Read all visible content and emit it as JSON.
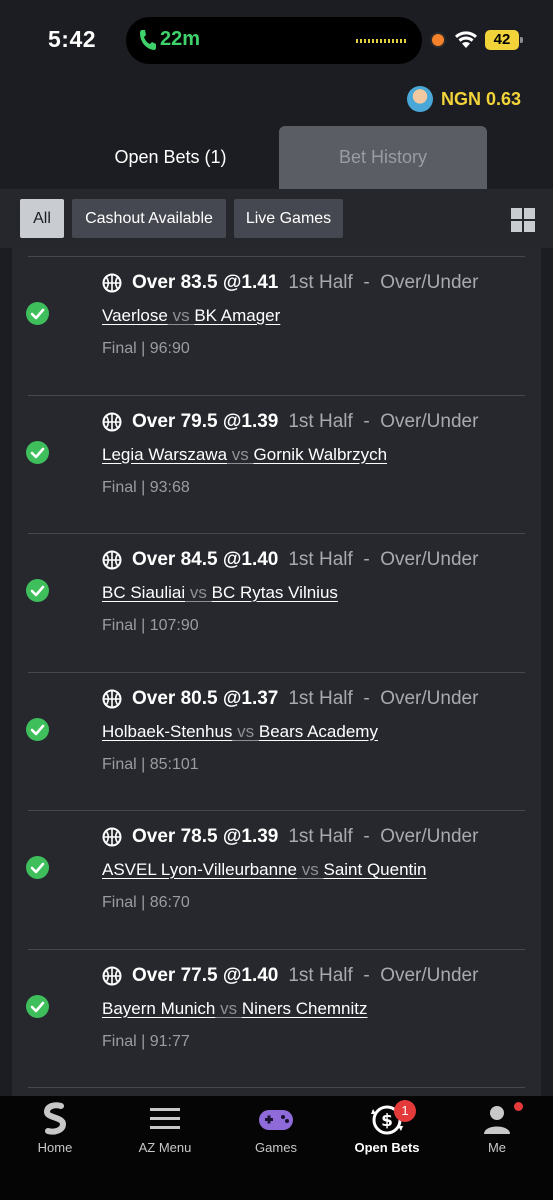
{
  "status_bar": {
    "time": "5:42",
    "call_duration": "22m",
    "battery": "42"
  },
  "balance": {
    "text": "NGN 0.63"
  },
  "tabs": [
    {
      "label": "Open Bets (1)",
      "active": true
    },
    {
      "label": "Bet History",
      "active": false
    }
  ],
  "filters": [
    {
      "label": "All",
      "active": true
    },
    {
      "label": "Cashout Available",
      "active": false
    },
    {
      "label": "Live Games",
      "active": false
    }
  ],
  "bets": [
    {
      "pick": "Over 83.5 @1.41",
      "market": "1st Half  -  Over/Under",
      "home": "Vaerlose",
      "vs": "vs",
      "away": "BK Amager",
      "result": "Final | 96:90"
    },
    {
      "pick": "Over 79.5 @1.39",
      "market": "1st Half  -  Over/Under",
      "home": "Legia Warszawa",
      "vs": "vs",
      "away": "Gornik Walbrzych",
      "result": "Final | 93:68"
    },
    {
      "pick": "Over 84.5 @1.40",
      "market": "1st Half  -  Over/Under",
      "home": "BC Siauliai",
      "vs": "vs",
      "away": "BC Rytas Vilnius",
      "result": "Final | 107:90"
    },
    {
      "pick": "Over 80.5 @1.37",
      "market": "1st Half  -  Over/Under",
      "home": "Holbaek-Stenhus",
      "vs": "vs",
      "away": "Bears Academy",
      "result": "Final | 85:101"
    },
    {
      "pick": "Over 78.5 @1.39",
      "market": "1st Half  -  Over/Under",
      "home": "ASVEL Lyon-Villeurbanne",
      "vs": "vs",
      "away": "Saint Quentin",
      "result": "Final | 86:70"
    },
    {
      "pick": "Over 77.5 @1.40",
      "market": "1st Half  -  Over/Under",
      "home": "Bayern Munich",
      "vs": "vs",
      "away": "Niners Chemnitz",
      "result": "Final | 91:77"
    }
  ],
  "nav": [
    {
      "label": "Home",
      "icon": "sporty-logo-icon"
    },
    {
      "label": "AZ Menu",
      "icon": "menu-icon"
    },
    {
      "label": "Games",
      "icon": "gamepad-icon"
    },
    {
      "label": "Open Bets",
      "icon": "open-bets-icon",
      "badge": "1",
      "active": true
    },
    {
      "label": "Me",
      "icon": "user-icon"
    }
  ],
  "colors": {
    "background": "#1c1d22",
    "accent_yellow": "#f2d43a",
    "success_green": "#3fbf5c",
    "badge_red": "#e53a3a"
  }
}
